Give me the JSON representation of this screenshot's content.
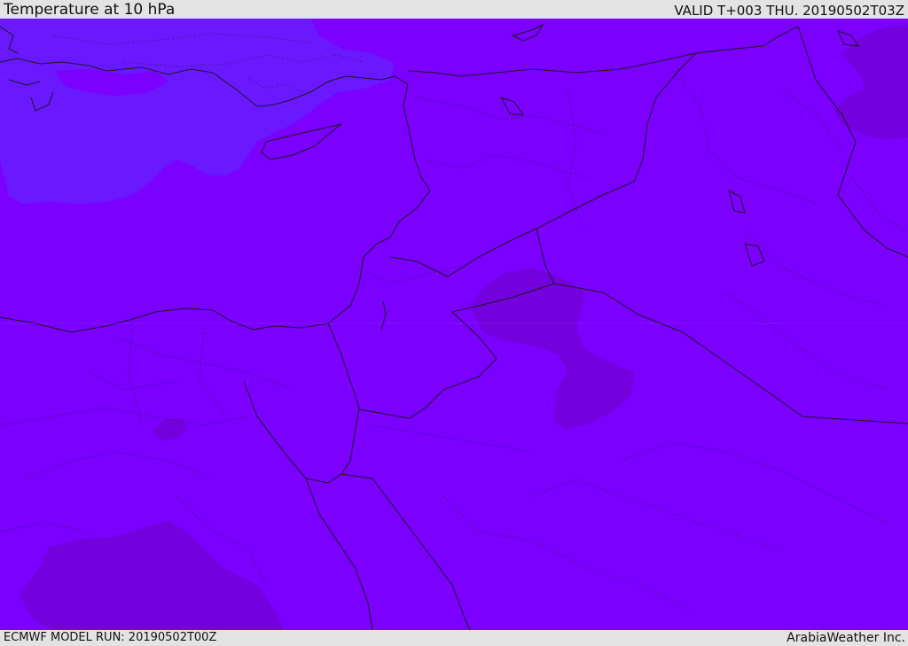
{
  "header": {
    "title": "Temperature at 10 hPa",
    "valid": "VALID T+003 THU. 20190502T03Z"
  },
  "footer": {
    "model_run": "ECMWF MODEL RUN: 20190502T00Z",
    "credit": "ArabiaWeather Inc."
  },
  "map": {
    "variable": "temperature",
    "level": "10 hPa",
    "colors": {
      "base_fill": "#7b00ff",
      "cool_area": "#6a18ff",
      "warm_area": "#7300dd",
      "coastline": "#1a1a1a",
      "borders_dotted": "#3a1a66"
    }
  }
}
